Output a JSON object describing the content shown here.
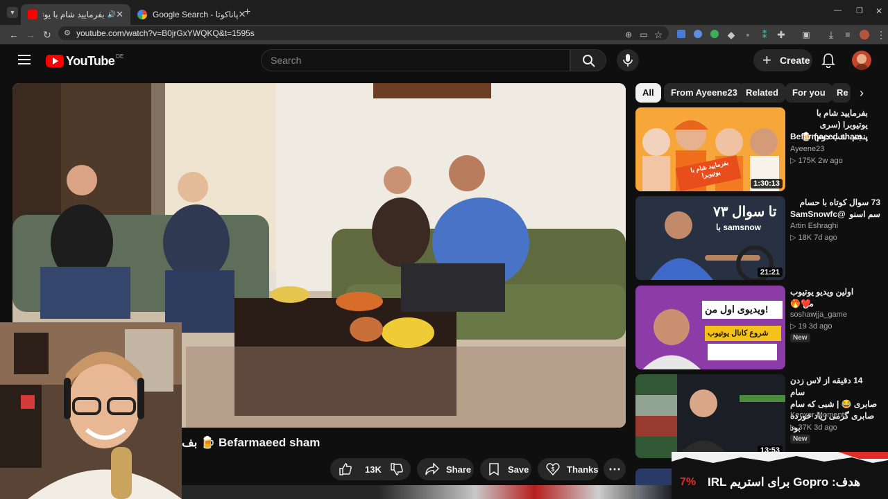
{
  "browser": {
    "tabs": [
      {
        "title": "بفرمایید شام با یوتیوبرا (سری",
        "active": true
      },
      {
        "title": "Google Search - پاناکوتا",
        "active": false
      }
    ],
    "url": "youtube.com/watch?v=B0jrGxYWQKQ&t=1595s",
    "new_tab": "+",
    "win_min": "—",
    "win_max": "❐",
    "win_close": "✕"
  },
  "youtube": {
    "logo": "YouTube",
    "region": "DE",
    "search_placeholder": "Search",
    "create_label": "Create"
  },
  "video": {
    "title": "بف 🍺 Befarmaeed sham",
    "likes": "13K",
    "share_label": "Share",
    "save_label": "Save",
    "thanks_label": "Thanks",
    "more": "⋯"
  },
  "chips": [
    "All",
    "From Ayeene23",
    "Related",
    "For you",
    "Re"
  ],
  "suggestions": [
    {
      "title_line1": "بفرمایید شام با یوتیوبرا (سری",
      "title_line2": "پنجم، شب دوم) 🍺",
      "title_line3": "Befarmaeed sham",
      "channel": "Ayeene23",
      "meta": "▷ 175K  2w ago",
      "duration": "1:30:13",
      "thumb_text": "بفرمایید شام با یوتیوبرا",
      "new": ""
    },
    {
      "title_line1": "73 سوال کوتاه با حسام سم اسنو",
      "title_line2": "SamSnowfc@",
      "title_line3": "",
      "channel": "Artin Eshraghi",
      "meta": "▷ 18K  7d ago",
      "duration": "21:21",
      "thumb_text": "۷۳ تا سوال",
      "thumb_sub": "با samsnow",
      "new": ""
    },
    {
      "title_line1": "اولین ویدیو یوتیوب من 🤩",
      "title_line2": "🔥❤️",
      "title_line3": "",
      "channel": "soshawjja_game",
      "meta": "▷ 19  3d ago",
      "duration": "",
      "thumb_text": "ویدیوی اول من!",
      "thumb_sub": "شروع کانال یوتیوب",
      "new": "New"
    },
    {
      "title_line1": "14 دقیقه از لاس زدن سام",
      "title_line2": "صابری 😂 | شبی که سام",
      "title_line3": "صابری گرمی زیاد خورده بود",
      "channel": "Keoxer Moments",
      "meta": "▷ 37K  3d ago",
      "duration": "13:53",
      "thumb_text": "",
      "new": "New"
    }
  ],
  "overlay": {
    "percent": "7%",
    "text": "هدف: Gopro برای استریم IRL"
  },
  "colors": {
    "accent": "#ff0000",
    "bg": "#0f0f0f",
    "chip": "#272727"
  }
}
